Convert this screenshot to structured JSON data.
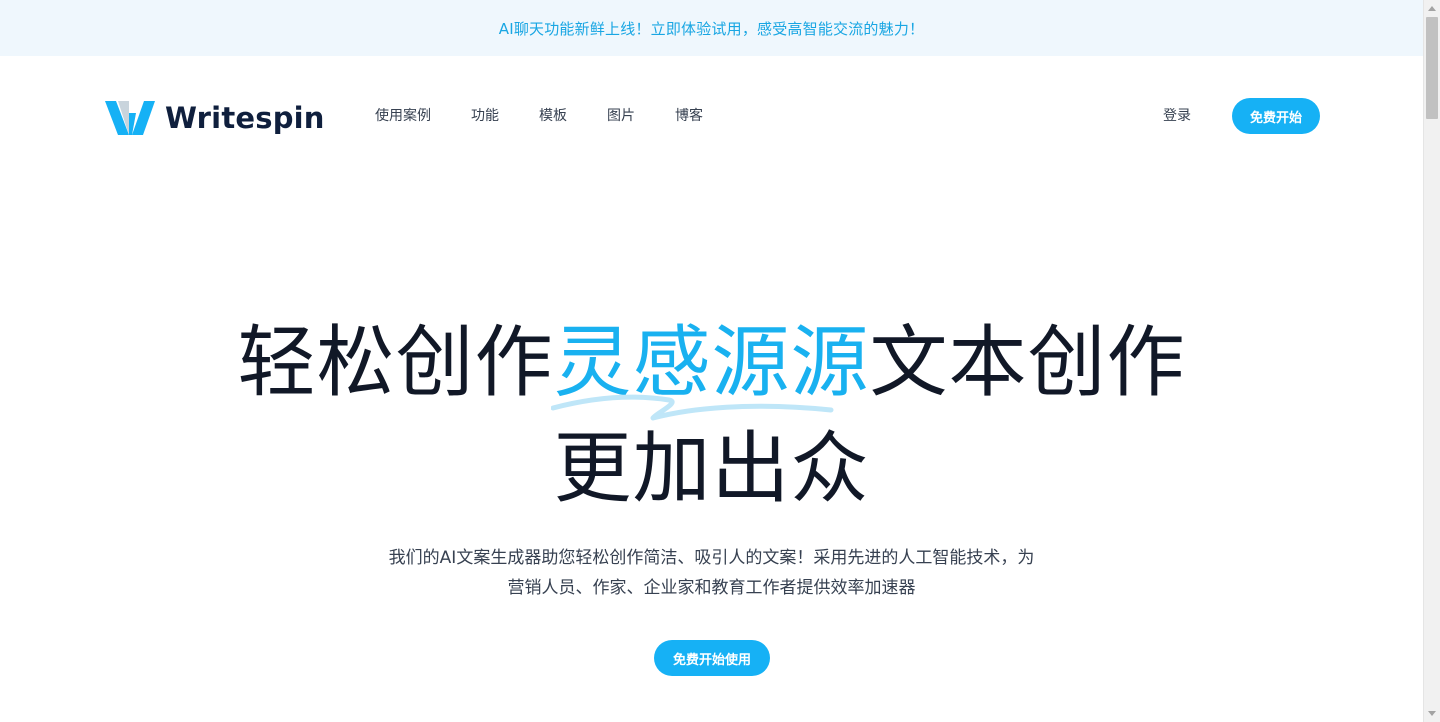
{
  "announcement": {
    "text": "AI聊天功能新鲜上线！立即体验试用，感受高智能交流的魅力！"
  },
  "header": {
    "logo_text": "Writespin",
    "nav": [
      {
        "label": "使用案例"
      },
      {
        "label": "功能"
      },
      {
        "label": "模板"
      },
      {
        "label": "图片"
      },
      {
        "label": "博客"
      }
    ],
    "login_label": "登录",
    "cta_label": "免费开始"
  },
  "hero": {
    "title_part1": "轻松创作",
    "title_highlight": "灵感源源",
    "title_part2": "文本创作",
    "title_line2": "更加出众",
    "subtitle_line1": "我们的AI文案生成器助您轻松创作简洁、吸引人的文案！采用先进的人工智能技术，为",
    "subtitle_line2": "营销人员、作家、企业家和教育工作者提供效率加速器",
    "cta_label": "免费开始使用"
  },
  "colors": {
    "accent": "#16b1f5",
    "announcement_bg": "#eff7fd",
    "announcement_text": "#19a6e3",
    "logo_dark": "#0f1f3d"
  }
}
